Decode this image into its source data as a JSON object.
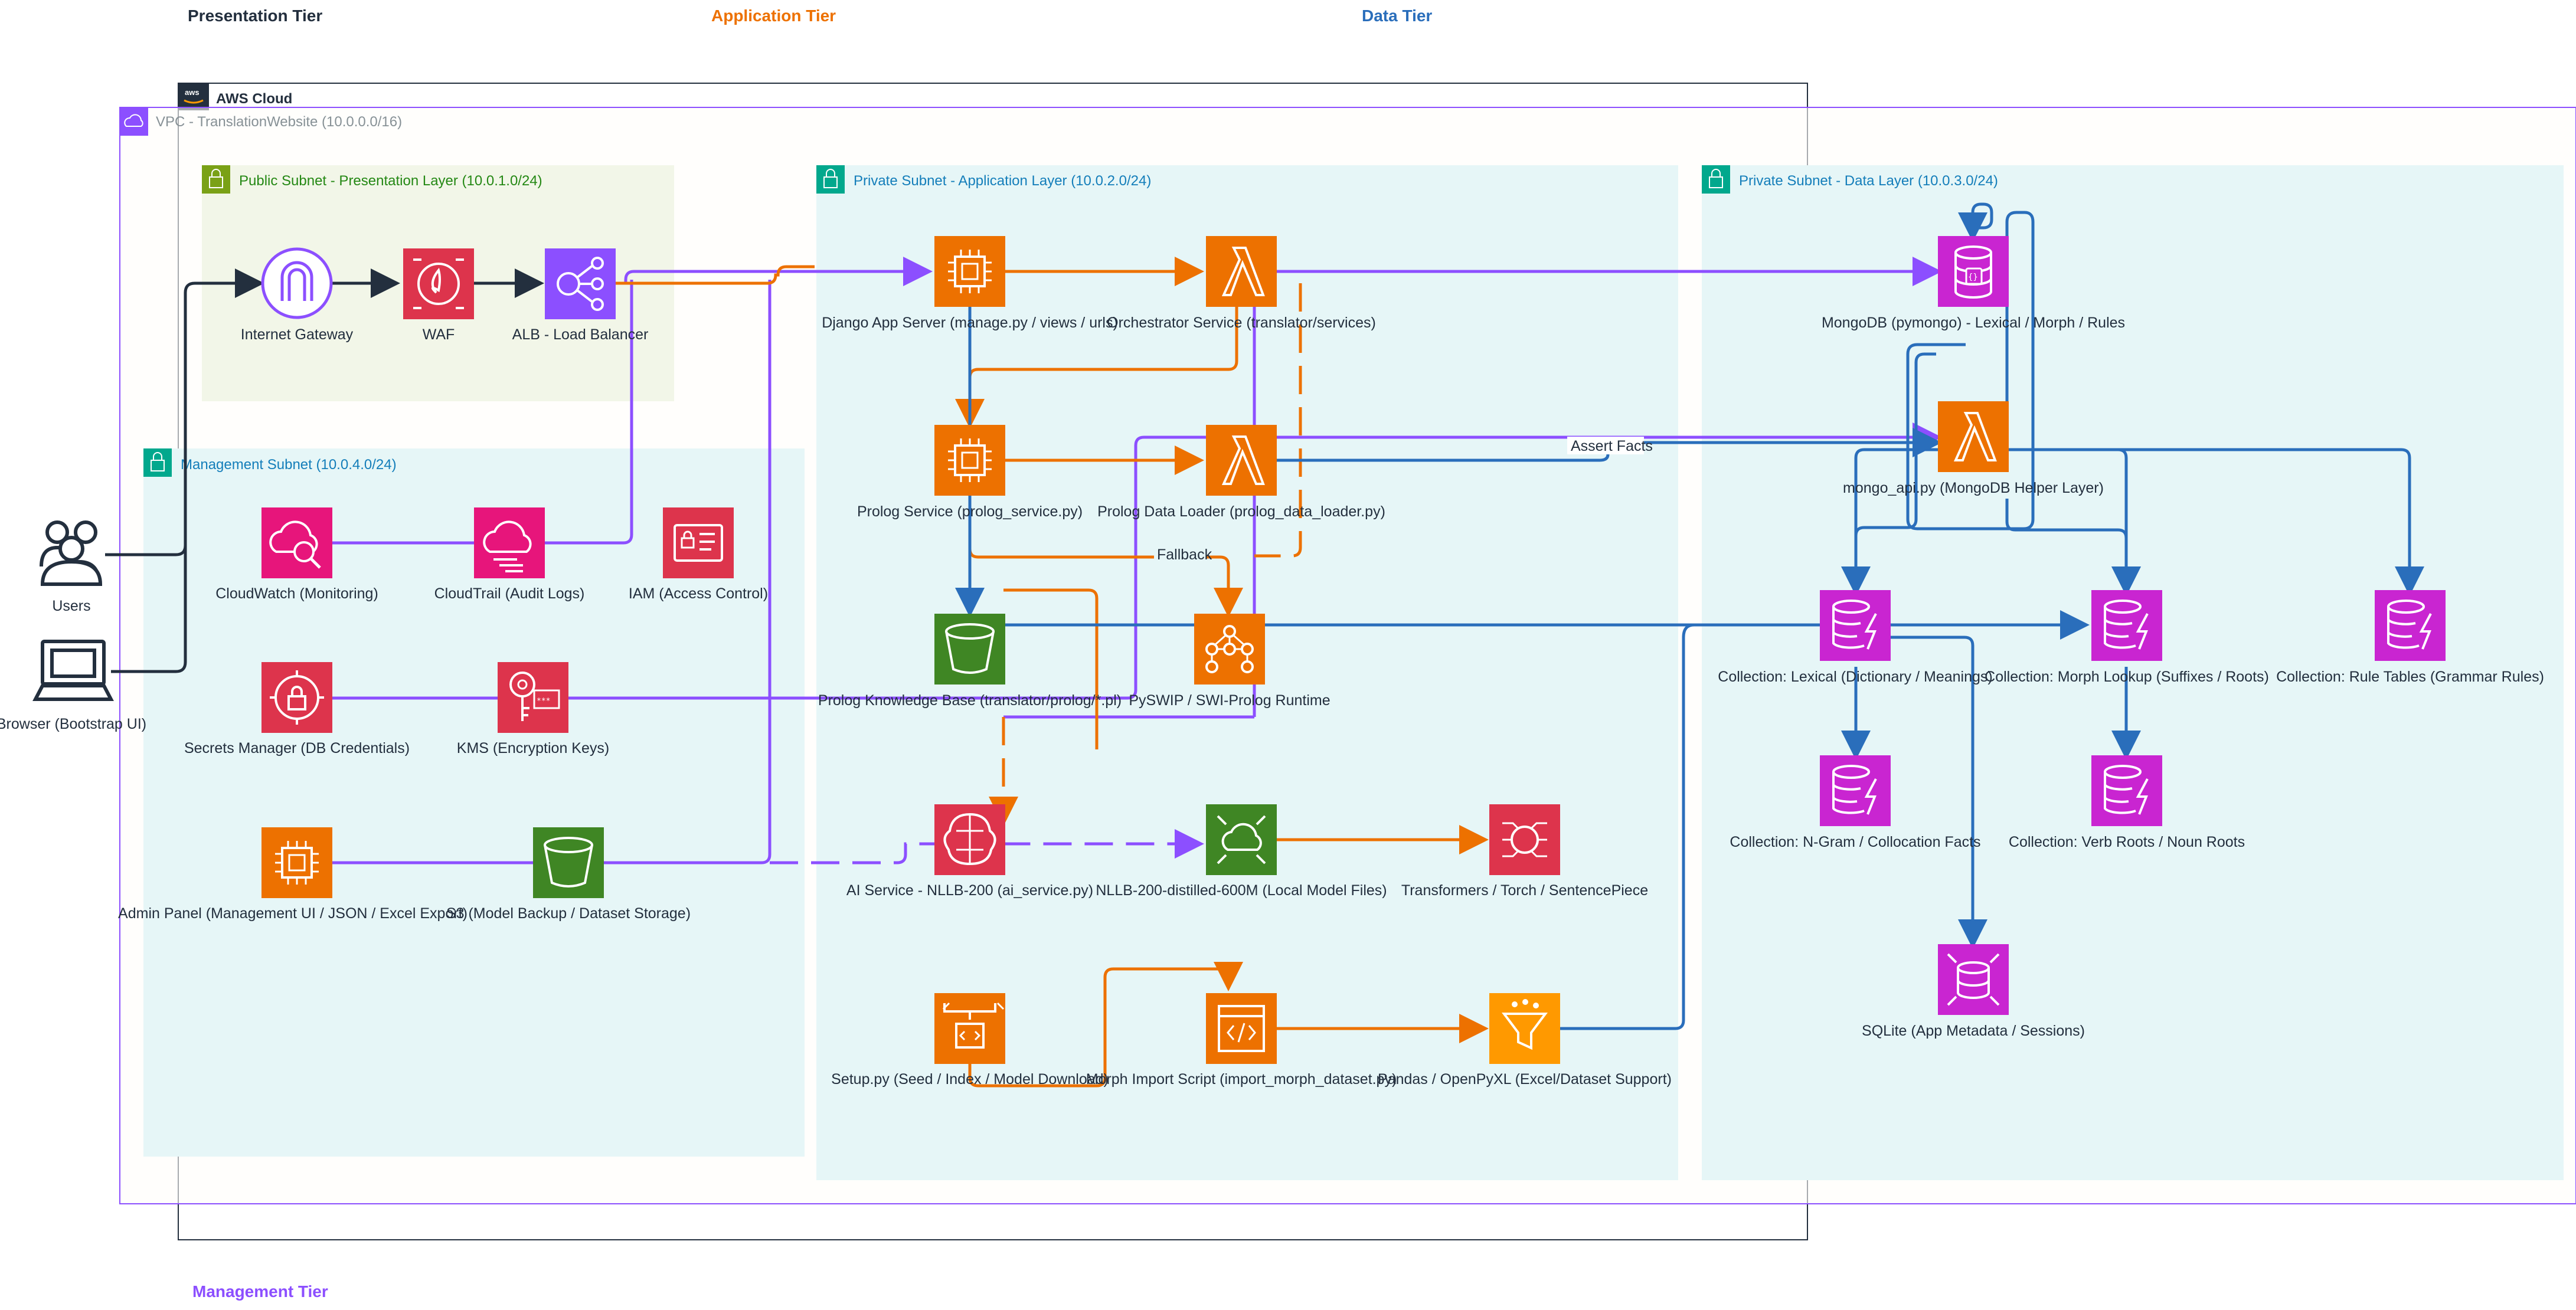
{
  "tiers": {
    "presentation": "Presentation Tier",
    "application": "Application Tier",
    "data": "Data Tier",
    "management": "Management Tier"
  },
  "groups": {
    "aws_cloud": "AWS Cloud",
    "vpc": "VPC - TranslationWebsite (10.0.0.0/16)",
    "public_subnet": "Public Subnet - Presentation Layer (10.0.1.0/24)",
    "management_subnet": "Management Subnet (10.0.4.0/24)",
    "app_subnet": "Private Subnet - Application Layer (10.0.2.0/24)",
    "data_subnet": "Private Subnet - Data Layer (10.0.3.0/24)"
  },
  "nodes": {
    "users": "Users",
    "browser": "Browser (Bootstrap UI)",
    "internet_gateway": "Internet Gateway",
    "waf": "WAF",
    "alb": "ALB - Load Balancer",
    "cloudwatch": "CloudWatch (Monitoring)",
    "cloudtrail": "CloudTrail (Audit Logs)",
    "iam": "IAM (Access Control)",
    "secrets_manager": "Secrets Manager (DB Credentials)",
    "kms": "KMS (Encryption Keys)",
    "admin_panel": "Admin Panel (Management UI / JSON / Excel Export)",
    "s3": "S3 (Model Backup / Dataset Storage)",
    "django": "Django App Server (manage.py / views / urls)",
    "orchestrator": "Orchestrator Service (translator/services)",
    "prolog_service": "Prolog Service (prolog_service.py)",
    "prolog_loader": "Prolog Data Loader (prolog_data_loader.py)",
    "prolog_kb": "Prolog Knowledge Base (translator/prolog/*.pl)",
    "pyswip": "PySWIP / SWI-Prolog Runtime",
    "ai_service": "AI Service - NLLB-200 (ai_service.py)",
    "nllb_model": "NLLB-200-distilled-600M (Local Model Files)",
    "transformers": "Transformers / Torch / SentencePiece",
    "setup": "Setup.py (Seed / Index / Model Download)",
    "morph_import": "Morph Import Script (import_morph_dataset.py)",
    "pandas": "Pandas / OpenPyXL (Excel/Dataset Support)",
    "mongodb": "MongoDB (pymongo) - Lexical / Morph / Rules",
    "mongo_api": "mongo_api.py (MongoDB Helper Layer)",
    "coll_lexical": "Collection: Lexical (Dictionary / Meanings)",
    "coll_morph": "Collection: Morph Lookup (Suffixes / Roots)",
    "coll_rules": "Collection: Rule Tables (Grammar Rules)",
    "coll_ngram": "Collection: N-Gram / Collocation Facts",
    "coll_verb": "Collection: Verb Roots / Noun Roots",
    "sqlite": "SQLite (App Metadata / Sessions)"
  },
  "edge_labels": {
    "assert_facts": "Assert Facts",
    "fallback": "Fallback"
  },
  "colors": {
    "compute": "#ed7100",
    "security": "#dd344c",
    "management": "#e7157b",
    "networking": "#8c4fff",
    "storage": "#3f8624",
    "database": "#c925d1",
    "ml": "#dd344c",
    "analytics": "#ff9900",
    "edge_purple": "#8c4fff",
    "edge_orange": "#ed7100",
    "edge_blue": "#2a6ebb",
    "edge_dark": "#232f3e"
  }
}
